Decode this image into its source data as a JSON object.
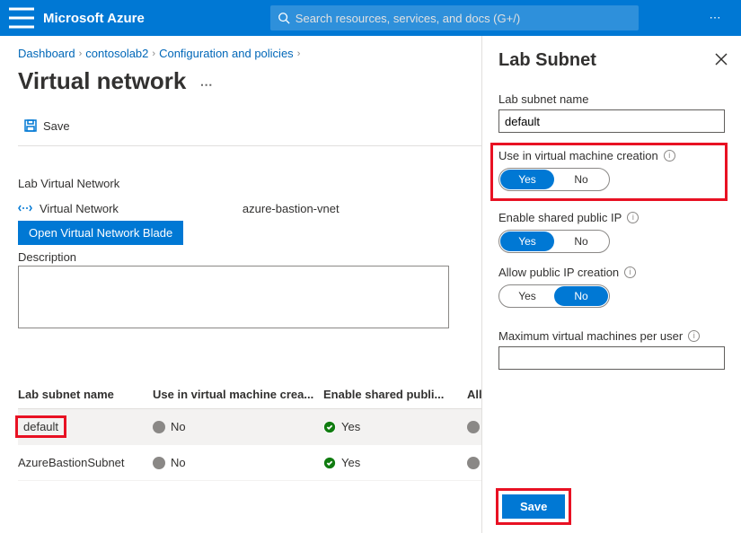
{
  "topbar": {
    "brand": "Microsoft Azure",
    "search_placeholder": "Search resources, services, and docs (G+/)"
  },
  "breadcrumb": {
    "items": [
      "Dashboard",
      "contosolab2",
      "Configuration and policies"
    ]
  },
  "page": {
    "title": "Virtual network",
    "save_label": "Save",
    "section_label": "Lab Virtual Network",
    "vnet_link_label": "Virtual Network",
    "vnet_name": "azure-bastion-vnet",
    "open_blade_label": "Open Virtual Network Blade",
    "description_label": "Description"
  },
  "table": {
    "headers": {
      "c1": "Lab subnet name",
      "c2": "Use in virtual machine crea...",
      "c3": "Enable shared publi...",
      "c4": "Allow..."
    },
    "rows": [
      {
        "name": "default",
        "use": "No",
        "shared": "Yes",
        "allow": "No",
        "highlight": true
      },
      {
        "name": "AzureBastionSubnet",
        "use": "No",
        "shared": "Yes",
        "allow": "No",
        "highlight": false
      }
    ]
  },
  "panel": {
    "title": "Lab Subnet",
    "name_label": "Lab subnet name",
    "name_value": "default",
    "use_label": "Use in virtual machine creation",
    "shared_label": "Enable shared public IP",
    "allow_label": "Allow public IP creation",
    "max_label": "Maximum virtual machines per user",
    "yes": "Yes",
    "no": "No",
    "save_label": "Save"
  }
}
